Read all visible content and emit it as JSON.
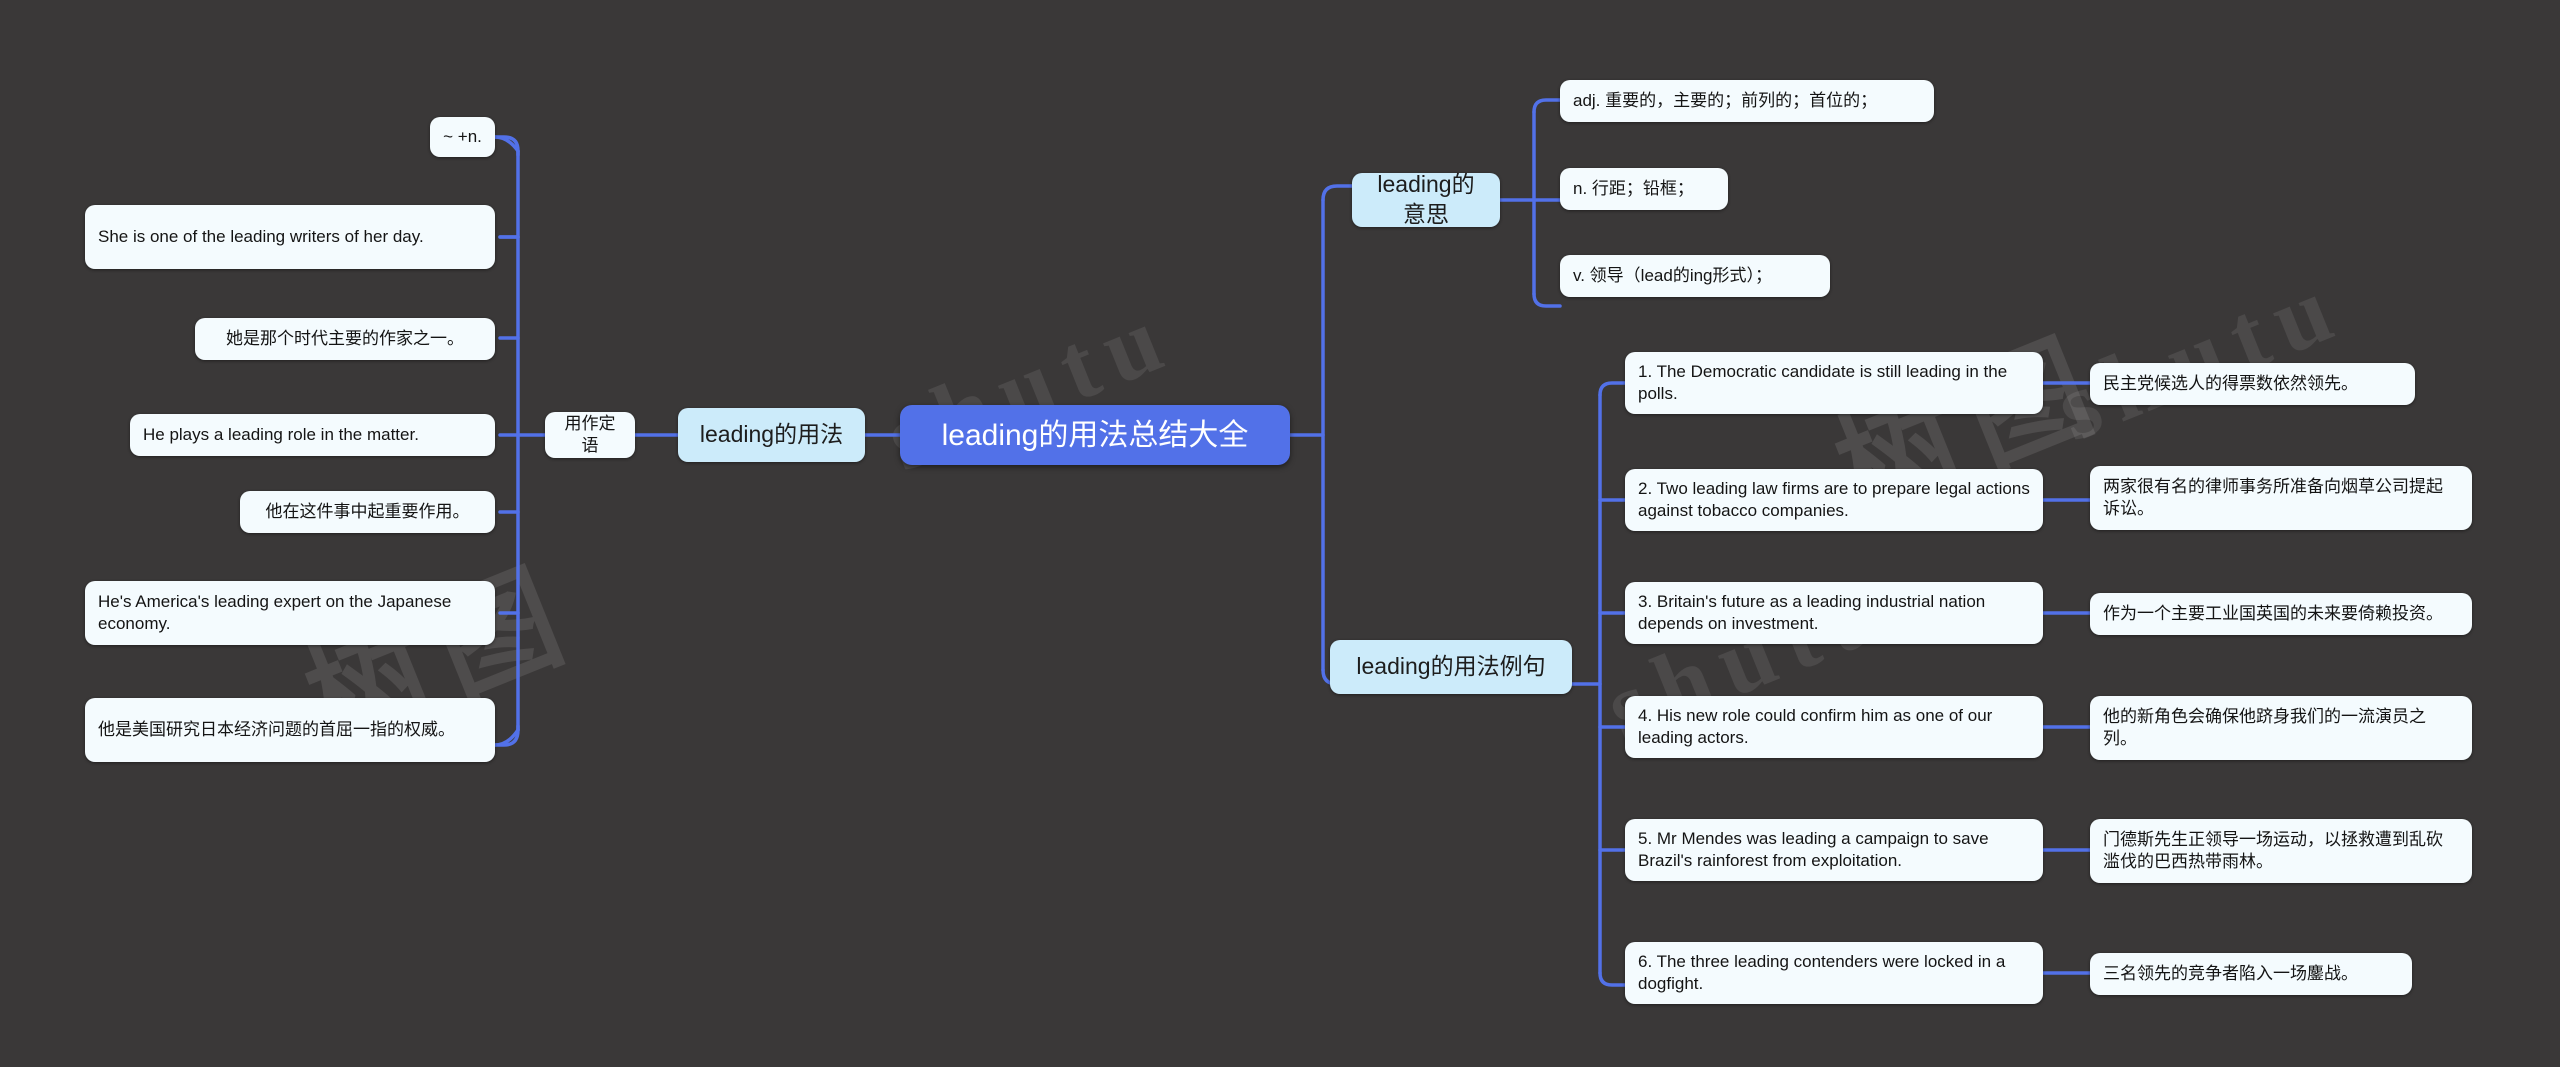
{
  "meta": {
    "background_color": "#3a3838",
    "link_color": "#5271e8",
    "root_color": "#5271e8",
    "branch_color": "#ccebfa",
    "leaf_color": "#f4fbfe"
  },
  "watermark": {
    "text_1": "树图",
    "text_2": "shutu",
    "text_3": "树图"
  },
  "root": {
    "label": "leading的用法总结大全"
  },
  "branches": {
    "usage": {
      "label": "leading的用法",
      "child": {
        "label": "用作定语",
        "leaves": [
          {
            "label": "~ +n."
          },
          {
            "label": "She is one of the leading writers of her day."
          },
          {
            "label": "她是那个时代主要的作家之一。"
          },
          {
            "label": "He plays a leading role in the matter."
          },
          {
            "label": "他在这件事中起重要作用。"
          },
          {
            "label": "He's America's leading expert on the Japanese economy."
          },
          {
            "label": "他是美国研究日本经济问题的首屈一指的权威。"
          }
        ]
      }
    },
    "meaning": {
      "label": "leading的意思",
      "leaves": [
        {
          "label": "adj. 重要的，主要的；前列的；首位的；"
        },
        {
          "label": "n. 行距；铅框；"
        },
        {
          "label": "v. 领导（lead的ing形式）；"
        }
      ]
    },
    "examples": {
      "label": "leading的用法例句",
      "items": [
        {
          "en": "1. The Democratic candidate is still leading in the polls.",
          "cn": "民主党候选人的得票数依然领先。"
        },
        {
          "en": "2. Two leading law firms are to prepare legal actions against tobacco companies.",
          "cn": "两家很有名的律师事务所准备向烟草公司提起诉讼。"
        },
        {
          "en": "3. Britain's future as a leading industrial nation depends on investment.",
          "cn": "作为一个主要工业国英国的未来要倚赖投资。"
        },
        {
          "en": "4. His new role could confirm him as one of our leading actors.",
          "cn": "他的新角色会确保他跻身我们的一流演员之列。"
        },
        {
          "en": "5. Mr Mendes was leading a campaign to save Brazil's rainforest from exploitation.",
          "cn": "门德斯先生正领导一场运动，以拯救遭到乱砍滥伐的巴西热带雨林。"
        },
        {
          "en": "6. The three leading contenders were locked in a dogfight.",
          "cn": "三名领先的竞争者陷入一场鏖战。"
        }
      ]
    }
  }
}
